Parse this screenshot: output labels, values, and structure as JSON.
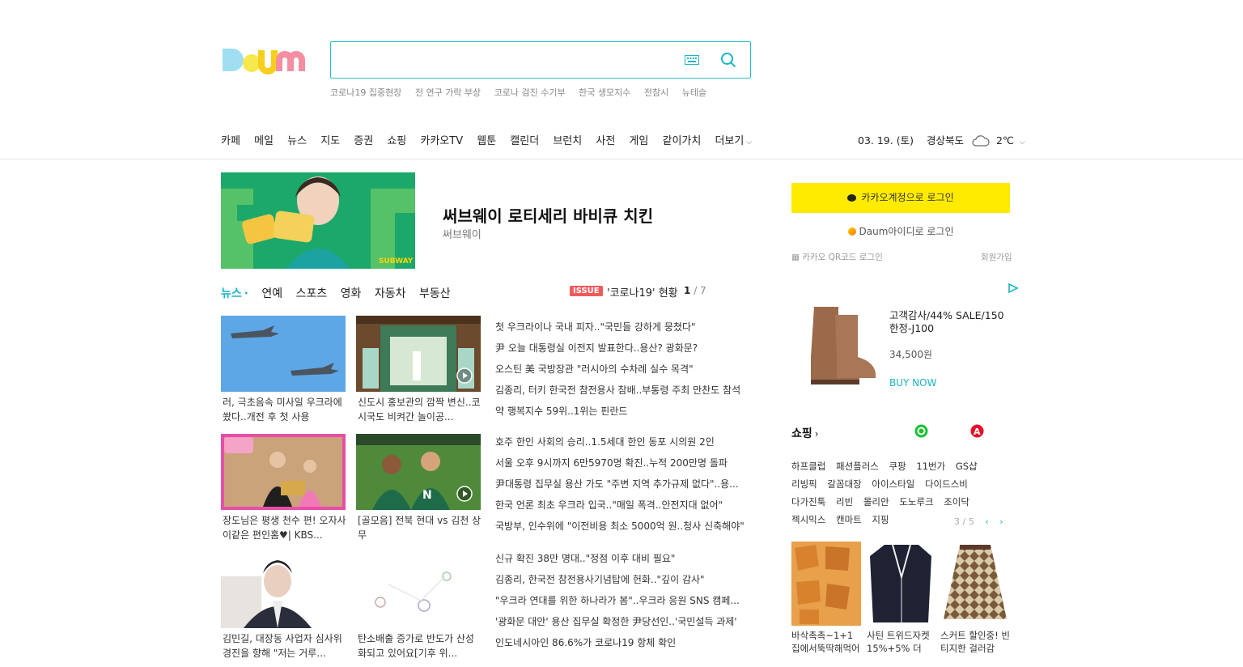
{
  "header": {
    "logo_alt": "Daum",
    "search_placeholder": "",
    "trends": [
      "코로나19 집중현장",
      "전 연구 가락 부상",
      "코로나 검진 수기부",
      "한국 생모지수",
      "전참시",
      "뉴테슬"
    ]
  },
  "gnb": {
    "items": [
      "카페",
      "메일",
      "뉴스",
      "지도",
      "증권",
      "쇼핑",
      "카카오TV",
      "웹툰",
      "캘린더",
      "브런치",
      "사전",
      "게임",
      "같이가치"
    ],
    "more_label": "더보기"
  },
  "weather": {
    "date": "03. 19. (토)",
    "region": "경상북도",
    "temp": "2℃"
  },
  "feature": {
    "title": "써브웨이 로티세리 바비큐 치킨",
    "subtitle": "써브웨이"
  },
  "tabs": {
    "items": [
      "뉴스",
      "연예",
      "스포츠",
      "영화",
      "자동차",
      "부동산"
    ]
  },
  "issue": {
    "badge": "ISSUE",
    "text": "'코로나19' 현황",
    "page_current": "1",
    "page_total": "/ 7"
  },
  "cards": [
    {
      "caption": "러, 극초음속 미사일 우크라에 쐈다..개전 후 첫 사용"
    },
    {
      "caption": "신도시 홍보관의 깜짝 변신..코시국도 비켜간 놀이공..."
    },
    {
      "caption": "장도님은 평생 천수 편! 오자사이같은 편인홈♥| KBS..."
    },
    {
      "caption": "[골모음] 전북 현대 vs 김천 상무"
    },
    {
      "caption": "김민길, 대장동 사업자 심사위 경진을 향해 \"저는 거루..."
    },
    {
      "caption": "탄소배출 증가로 반도가 산성화되고 있어요[기후 위..."
    }
  ],
  "news_group_1": [
    "첫 우크라이나 국내 피자..\"국민들 강하게 뭉쳤다\"",
    "尹 오늘 대통령실 이전지 발표한다..용산? 광화문?",
    "오스틴 美 국방장관 \"러시아의 수차례 실수 목격\"",
    "김종리, 터키 한국전 참전용사 참배..부통령 주최 만찬도 참석",
    "약 행복지수 59위..1위는 핀란드"
  ],
  "news_group_2": [
    "호주 한인 사회의 승리..1.5세대 한인 동포 시의원 2인",
    "서울 오후 9시까지 6만5970명 확진..누적 200만명 돌파",
    "尹대통령 집무실 용산 가도 \"주변 지역 추가규제 없다\"..용...",
    "한국 언론 최초 우크라 입국..\"매일 폭격..안전지대 없어\"",
    "국방부, 인수위에 \"이전비용 최소 5000억 원..청사 신축해야\""
  ],
  "news_group_3": [
    "신규 확진 38만 명대..\"정점 이후 대비 필요\"",
    "김종리, 한국전 참전용사기념탑에 헌화..\"깊이 감사\"",
    "\"우크라 연대를 위한 하나라가 봄\"..우크라 응원 SNS 캠페...",
    "'광화문 대안' 용산 집무실 확정한 尹당선인..'국민설득 과제'",
    "인도네시아인 86.6%가 코로나19 항체 확인"
  ],
  "login": {
    "kakao_label": "카카오계정으로 로그인",
    "daum_label": "Daum아이디로 로그인",
    "qr_label": "카카오 QR코드 로그인",
    "signup_label": "회원가입"
  },
  "ad": {
    "title": "고객감사/44% SALE/150한정-J100",
    "price": "34,500원",
    "cta": "BUY NOW"
  },
  "shopping": {
    "title": "쇼핑",
    "links": [
      "하프클럽",
      "패션플러스",
      "쿠팡",
      "11번가",
      "GS샵",
      "리빙픽",
      "갈꼼대장",
      "아이스타일",
      "다이드스비",
      "다가진툭",
      "리빈",
      "몰리안",
      "도노루크",
      "조이닥",
      "젝시믹스",
      "캔마트",
      "지핑"
    ],
    "pager": "3 / 5"
  },
  "products": [
    {
      "caption": "바삭촉촉~1+1 집에서뚝딱해먹어"
    },
    {
      "caption": "사틴 트위드자켓 15%+5% 더"
    },
    {
      "caption": "스커트 할인중! 빈티지한 걸러감"
    }
  ]
}
